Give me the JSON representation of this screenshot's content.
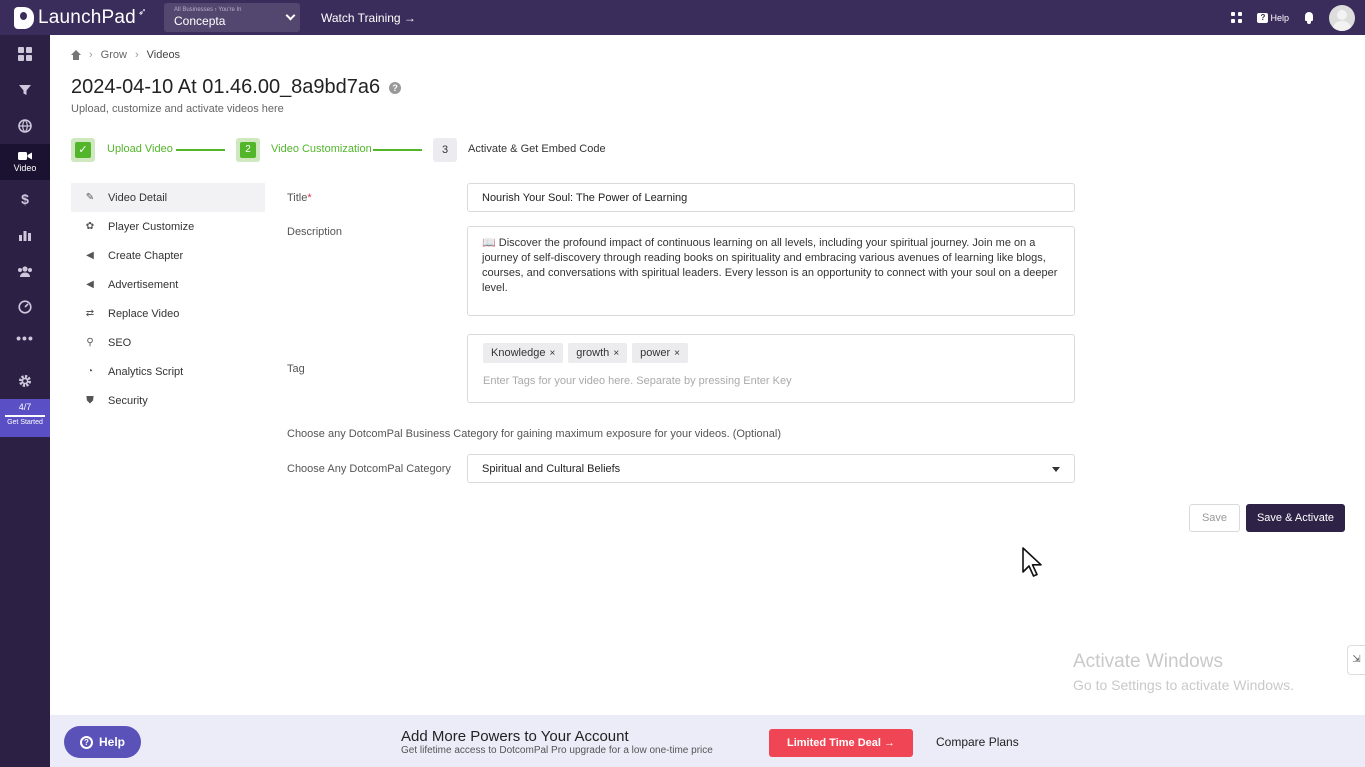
{
  "topbar": {
    "logo_text": "LaunchPad",
    "business_crumb": "All Businesses › You're In",
    "business_name": "Concepta",
    "watch_training": "Watch Training →",
    "help_label": "Help"
  },
  "sidebar": {
    "active_label": "Video",
    "get_started_progress": "4/7",
    "get_started_label": "Get Started"
  },
  "breadcrumb": {
    "items": [
      "Grow",
      "Videos"
    ]
  },
  "page": {
    "title": "2024-04-10 At 01.46.00_8a9bd7a6",
    "subtitle": "Upload, customize and activate videos here"
  },
  "stepper": {
    "steps": [
      {
        "number": "",
        "label": "Upload Video",
        "state": "done"
      },
      {
        "number": "2",
        "label": "Video Customization",
        "state": "current"
      },
      {
        "number": "3",
        "label": "Activate & Get Embed Code",
        "state": "pending"
      }
    ]
  },
  "menu": {
    "items": [
      {
        "label": "Video Detail",
        "icon": "edit-icon"
      },
      {
        "label": "Player Customize",
        "icon": "palette-icon"
      },
      {
        "label": "Create Chapter",
        "icon": "megaphone-icon"
      },
      {
        "label": "Advertisement",
        "icon": "megaphone-icon"
      },
      {
        "label": "Replace Video",
        "icon": "swap-icon"
      },
      {
        "label": "SEO",
        "icon": "search-icon"
      },
      {
        "label": "Analytics Script",
        "icon": "chart-icon"
      },
      {
        "label": "Security",
        "icon": "shield-icon"
      }
    ]
  },
  "form": {
    "title_label": "Title",
    "title_required": "*",
    "title_value": "Nourish Your Soul: The Power of Learning",
    "description_label": "Description",
    "description_value": "📖 Discover the profound impact of continuous learning on all levels, including your spiritual journey. Join me on a journey of self-discovery through reading books on spirituality and embracing various avenues of learning like blogs, courses, and conversations with spiritual leaders. Every lesson is an opportunity to connect with your soul on a deeper level.",
    "tag_label": "Tag",
    "tags": [
      "Knowledge",
      "growth",
      "power"
    ],
    "tag_remove": "×",
    "tag_placeholder": "Enter Tags for your video here. Separate by pressing Enter Key",
    "category_note": "Choose any DotcomPal Business Category for gaining maximum exposure for your videos. (Optional)",
    "category_label": "Choose Any DotcomPal Category",
    "category_value": "Spiritual and Cultural Beliefs",
    "save_label": "Save",
    "save_activate_label": "Save & Activate"
  },
  "watermark": {
    "line1": "Activate Windows",
    "line2": "Go to Settings to activate Windows."
  },
  "banner": {
    "help_label": "Help",
    "title": "Add More Powers to Your Account",
    "subtitle": "Get lifetime access to DotcomPal Pro upgrade for a low one-time price",
    "deal_label": "Limited Time Deal →",
    "compare_label": "Compare Plans"
  },
  "colors": {
    "topbar": "#3b2d5b",
    "sidebar": "#2c2044",
    "accent_green": "#52b52a",
    "primary_button": "#2f2247",
    "deal_red": "#f04555"
  }
}
